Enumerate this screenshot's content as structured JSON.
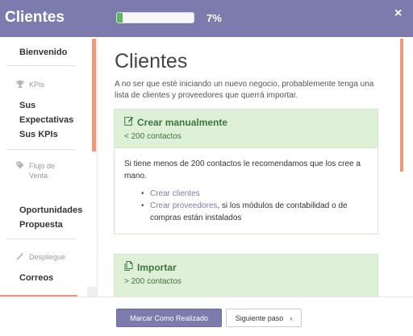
{
  "header": {
    "title": "Clientes",
    "progress_fraction": 0.07,
    "progress_label": "7%",
    "close_glyph": "×"
  },
  "sidebar": {
    "steps": {
      "bienvenido": "Bienvenido",
      "sus_expectativas_1": "Sus",
      "sus_expectativas_2": "Expectativas",
      "sus_kpis": "Sus KPIs",
      "oportunidades": "Oportunidades",
      "propuesta": "Propuesta",
      "correos": "Correos"
    },
    "sections": {
      "kpis": {
        "label": "KPIs",
        "icon": "trophy-icon"
      },
      "flujo_1": {
        "label": "Flujo de",
        "icon": "tag-icon"
      },
      "flujo_2": "Venta",
      "despliegue": {
        "label": "Despliegue",
        "icon": "magic-wand-icon"
      }
    }
  },
  "main": {
    "title": "Clientes",
    "description": "A no ser que esté iniciando un nuevo negocio, probablemente tenga una lista de clientes y proveedores que querrá importar.",
    "cards": {
      "manual": {
        "title": "Crear manualmente",
        "icon": "edit-icon",
        "subtitle": "< 200 contactos",
        "body": "Si tiene menos de 200 contactos le recomendamos que los cree a mano.",
        "link_clientes": "Crear clientes",
        "link_proveedores": "Crear proveedores",
        "proveedores_suffix": ", si los módulos de contabilidad o de compras están instalados"
      },
      "import": {
        "title": "Importar",
        "icon": "copy-icon",
        "subtitle": "> 200 contactos"
      }
    }
  },
  "footer": {
    "done_label": "Marcar Como Realizado",
    "next_label": "Siguiente paso",
    "next_glyph": "›"
  },
  "colors": {
    "brand": "#7c7bad",
    "accent": "#f0997a",
    "success_bg": "#dff0d8",
    "success_text": "#3c763d"
  }
}
